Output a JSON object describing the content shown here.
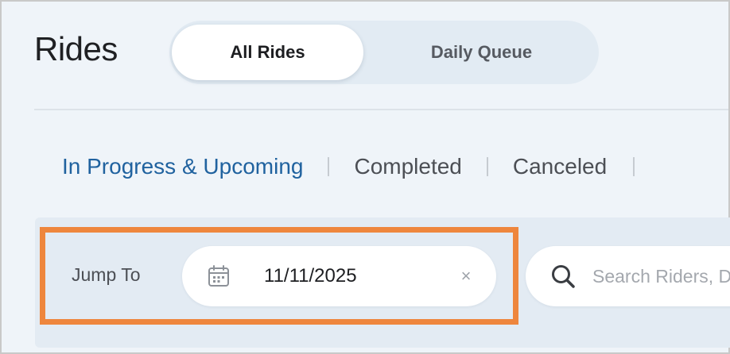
{
  "page": {
    "title": "Rides"
  },
  "view_toggle": {
    "options": [
      "All Rides",
      "Daily Queue"
    ],
    "selected": "All Rides"
  },
  "status_tabs": {
    "items": [
      "In Progress & Upcoming",
      "Completed",
      "Canceled"
    ],
    "selected": "In Progress & Upcoming"
  },
  "filters": {
    "jump_to": {
      "label": "Jump To",
      "date_value": "11/11/2025",
      "clear_icon": "×"
    },
    "search": {
      "placeholder": "Search Riders, Drivers"
    }
  },
  "colors": {
    "accent": "#20629f",
    "highlight_box": "#ee863d",
    "background": "#eff4f9",
    "toggle_track": "#e2ebf3"
  }
}
